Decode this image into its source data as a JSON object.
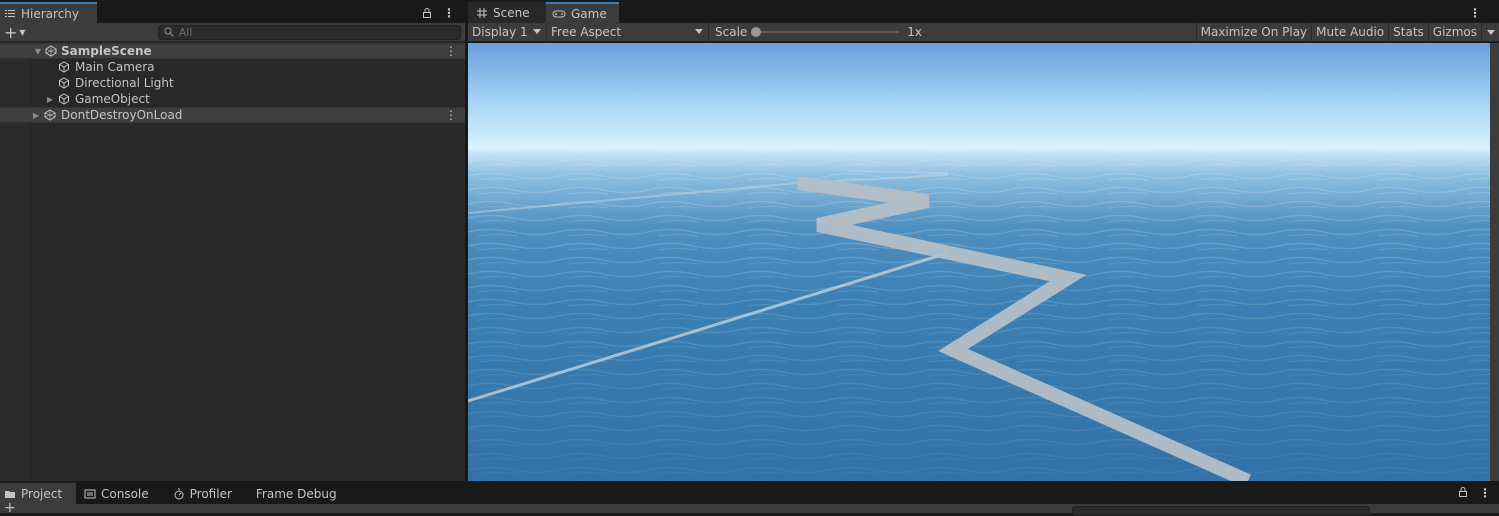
{
  "hierarchy": {
    "tab_label": "Hierarchy",
    "search_placeholder": "All",
    "items": [
      {
        "label": "SampleScene",
        "type": "scene",
        "expanded": true
      },
      {
        "label": "Main Camera",
        "type": "gameobject"
      },
      {
        "label": "Directional Light",
        "type": "gameobject"
      },
      {
        "label": "GameObject",
        "type": "gameobject",
        "collapsed": true
      },
      {
        "label": "DontDestroyOnLoad",
        "type": "scene",
        "collapsed": true
      }
    ]
  },
  "game": {
    "tabs": [
      {
        "label": "Scene",
        "icon": "grid-icon",
        "active": false
      },
      {
        "label": "Game",
        "icon": "gamepad-icon",
        "active": true
      }
    ],
    "toolbar": {
      "display": "Display 1",
      "aspect": "Free Aspect",
      "scale_label": "Scale",
      "scale_value": "1x",
      "maximize": "Maximize On Play",
      "mute": "Mute Audio",
      "stats": "Stats",
      "gizmos": "Gizmos"
    }
  },
  "bottom": {
    "tabs": [
      {
        "label": "Project",
        "icon": "folder-icon",
        "active": true
      },
      {
        "label": "Console",
        "icon": "console-icon",
        "active": false
      },
      {
        "label": "Profiler",
        "icon": "profiler-icon",
        "active": false
      },
      {
        "label": "Frame Debug",
        "icon": "",
        "active": false
      }
    ]
  },
  "colors": {
    "accent": "#3a79bb",
    "panel": "#3c3c3c",
    "dark": "#282828"
  }
}
